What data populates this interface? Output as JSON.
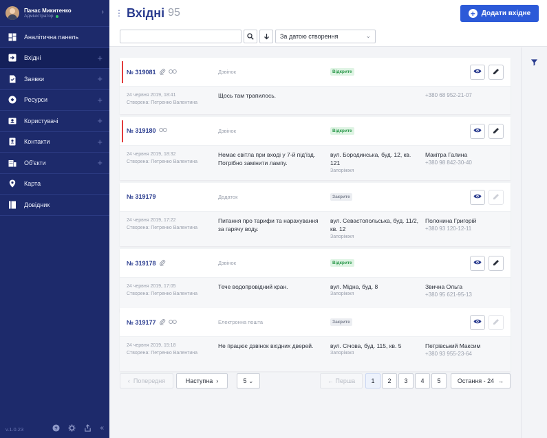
{
  "user": {
    "name": "Панас Микитенко",
    "role": "Адміністратор"
  },
  "sidebar": {
    "items": [
      {
        "label": "Аналітична панель",
        "icon": "dashboard-icon",
        "plus": false
      },
      {
        "label": "Вхідні",
        "icon": "inbox-icon",
        "plus": true,
        "active": true
      },
      {
        "label": "Заявки",
        "icon": "document-icon",
        "plus": true
      },
      {
        "label": "Ресурси",
        "icon": "resources-icon",
        "plus": true
      },
      {
        "label": "Користувачі",
        "icon": "users-icon",
        "plus": true
      },
      {
        "label": "Контакти",
        "icon": "contacts-icon",
        "plus": true
      },
      {
        "label": "Об'єкти",
        "icon": "building-icon",
        "plus": true
      },
      {
        "label": "Карта",
        "icon": "map-pin-icon",
        "plus": false
      },
      {
        "label": "Довідник",
        "icon": "book-icon",
        "plus": false
      }
    ],
    "version": "v.1.0.23"
  },
  "header": {
    "title": "Вхідні",
    "count": "95",
    "add_label": "Додати вхідне"
  },
  "toolbar": {
    "search_placeholder": "",
    "sort_label": "За датою створення"
  },
  "cards": [
    {
      "number": "№ 319081",
      "attach": true,
      "link": true,
      "type": "Дзвінок",
      "status": "Відкрите",
      "open": true,
      "urgent": true,
      "date": "24 червня 2019, 18:41",
      "author": "Створена: Петренко Валентина",
      "desc": "Щось там трапилось.",
      "addr": "",
      "city": "",
      "contact_name": "",
      "phone": "+380 68 952-21-07",
      "editable": true
    },
    {
      "number": "№ 319180",
      "attach": false,
      "link": true,
      "type": "Дзвінок",
      "status": "Відкрите",
      "open": true,
      "urgent": true,
      "date": "24 червня 2019, 18:32",
      "author": "Створена: Петренко Валентина",
      "desc": "Немає світла при вході у 7-й під'їзд. Потрібно замінити лампу.",
      "addr": "вул. Бородинська, буд. 12, кв. 121",
      "city": "Запоріжжя",
      "contact_name": "Макітра Галина",
      "phone": "+380 98 842-30-40",
      "editable": true
    },
    {
      "number": "№ 319179",
      "attach": false,
      "link": false,
      "type": "Додаток",
      "status": "Закрите",
      "open": false,
      "urgent": false,
      "date": "24 червня 2019, 17:22",
      "author": "Створена: Петренко Валентина",
      "desc": "Питання про тарифи та нарахування за гарячу воду.",
      "addr": "вул. Севастопольська, буд. 11/2, кв. 12",
      "city": "Запоріжжя",
      "contact_name": "Полонина Григорій",
      "phone": "+380 93 120-12-11",
      "editable": false
    },
    {
      "number": "№ 319178",
      "attach": true,
      "link": false,
      "type": "Дзвінок",
      "status": "Відкрите",
      "open": true,
      "urgent": false,
      "date": "24 червня 2019, 17:05",
      "author": "Створена: Петренко Валентина",
      "desc": "Тече водопровідний кран.",
      "addr": "вул. Мідна, буд. 8",
      "city": "Запоріжжя",
      "contact_name": "Звична Ольга",
      "phone": "+380 95 621-95-13",
      "editable": true
    },
    {
      "number": "№ 319177",
      "attach": true,
      "link": true,
      "type": "Електронна пошта",
      "status": "Закрите",
      "open": false,
      "urgent": false,
      "date": "24 червня 2019, 15:18",
      "author": "Створена: Петренко Валентина",
      "desc": "Не працює дзвінок вхідних дверей.",
      "addr": "вул. Січова, буд. 115, кв. 5",
      "city": "Запоріжжя",
      "contact_name": "Петрівський Максим",
      "phone": "+380 93 955-23-64",
      "editable": false
    }
  ],
  "pagination": {
    "prev": "Попередня",
    "next": "Наступна",
    "per_page": "5",
    "first": "Перша",
    "pages": [
      "1",
      "2",
      "3",
      "4",
      "5"
    ],
    "current": "1",
    "last": "Остання - 24"
  },
  "colors": {
    "sidebar": "#1d2a6b",
    "accent": "#2c5ad8",
    "urgent": "#e23b3b",
    "open_badge": "#2e9a4d"
  }
}
